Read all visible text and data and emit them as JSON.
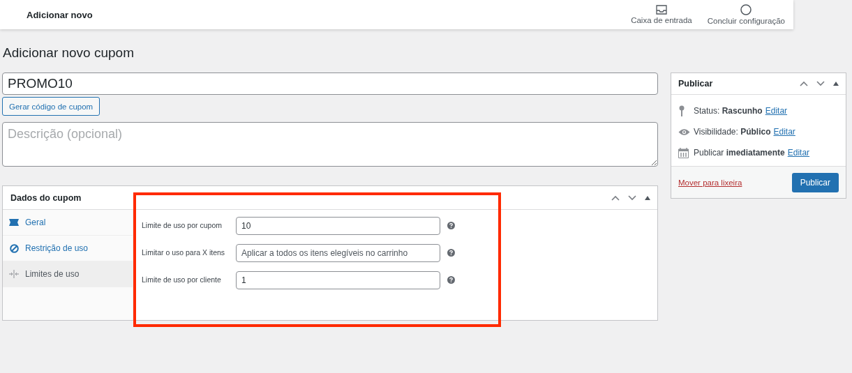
{
  "topbar": {
    "title": "Adicionar novo",
    "actions": [
      {
        "kind": "inbox",
        "label": "Caixa de entrada"
      },
      {
        "kind": "setup",
        "label": "Concluir configuração"
      }
    ]
  },
  "page_title": "Adicionar novo cupom",
  "coupon_code": {
    "value": "PROMO10"
  },
  "generate_button": "Gerar código de cupom",
  "description": {
    "placeholder": "Descrição (opcional)"
  },
  "coupon_data": {
    "title": "Dados do cupom",
    "tabs": [
      {
        "kind": "general",
        "label": "Geral",
        "selected": false
      },
      {
        "kind": "restriction",
        "label": "Restrição de uso",
        "selected": false
      },
      {
        "kind": "limits",
        "label": "Limites de uso",
        "selected": true
      }
    ],
    "fields": [
      {
        "label": "Limite de uso por cupom",
        "value": "10"
      },
      {
        "label": "Limitar o uso para X itens",
        "placeholder": "Aplicar a todos os itens elegíveis no carrinho"
      },
      {
        "label": "Limite de uso por cliente",
        "value": "1"
      }
    ]
  },
  "publish": {
    "title": "Publicar",
    "rows": [
      {
        "kind": "status",
        "text": "Status: **Rascunho**",
        "link": "Editar"
      },
      {
        "kind": "visibility",
        "text": "Visibilidade: **Público**",
        "link": "Editar"
      },
      {
        "kind": "schedule",
        "text": "Publicar **imediatamente**",
        "link": "Editar"
      }
    ],
    "trash_link": "Mover para lixeira",
    "publish_button": "Publicar"
  }
}
